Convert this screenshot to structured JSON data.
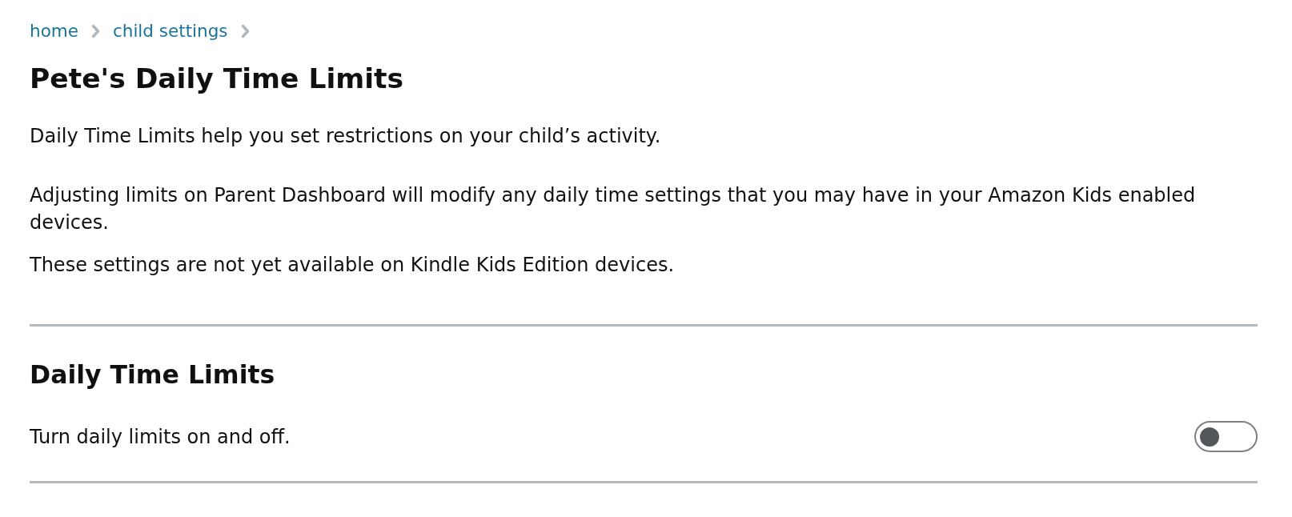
{
  "breadcrumb": [
    {
      "label": "home"
    },
    {
      "label": "child settings"
    }
  ],
  "title": "Pete's Daily Time Limits",
  "intro": [
    "Daily Time Limits help you set restrictions on your child’s activity.",
    "Adjusting limits on Parent Dashboard will modify any daily time settings that you may have in your Amazon Kids enabled devices.",
    "These settings are not yet available on Kindle Kids Edition devices."
  ],
  "section": {
    "heading": "Daily Time Limits",
    "description": "Turn daily limits on and off.",
    "toggle": {
      "on": false
    }
  }
}
